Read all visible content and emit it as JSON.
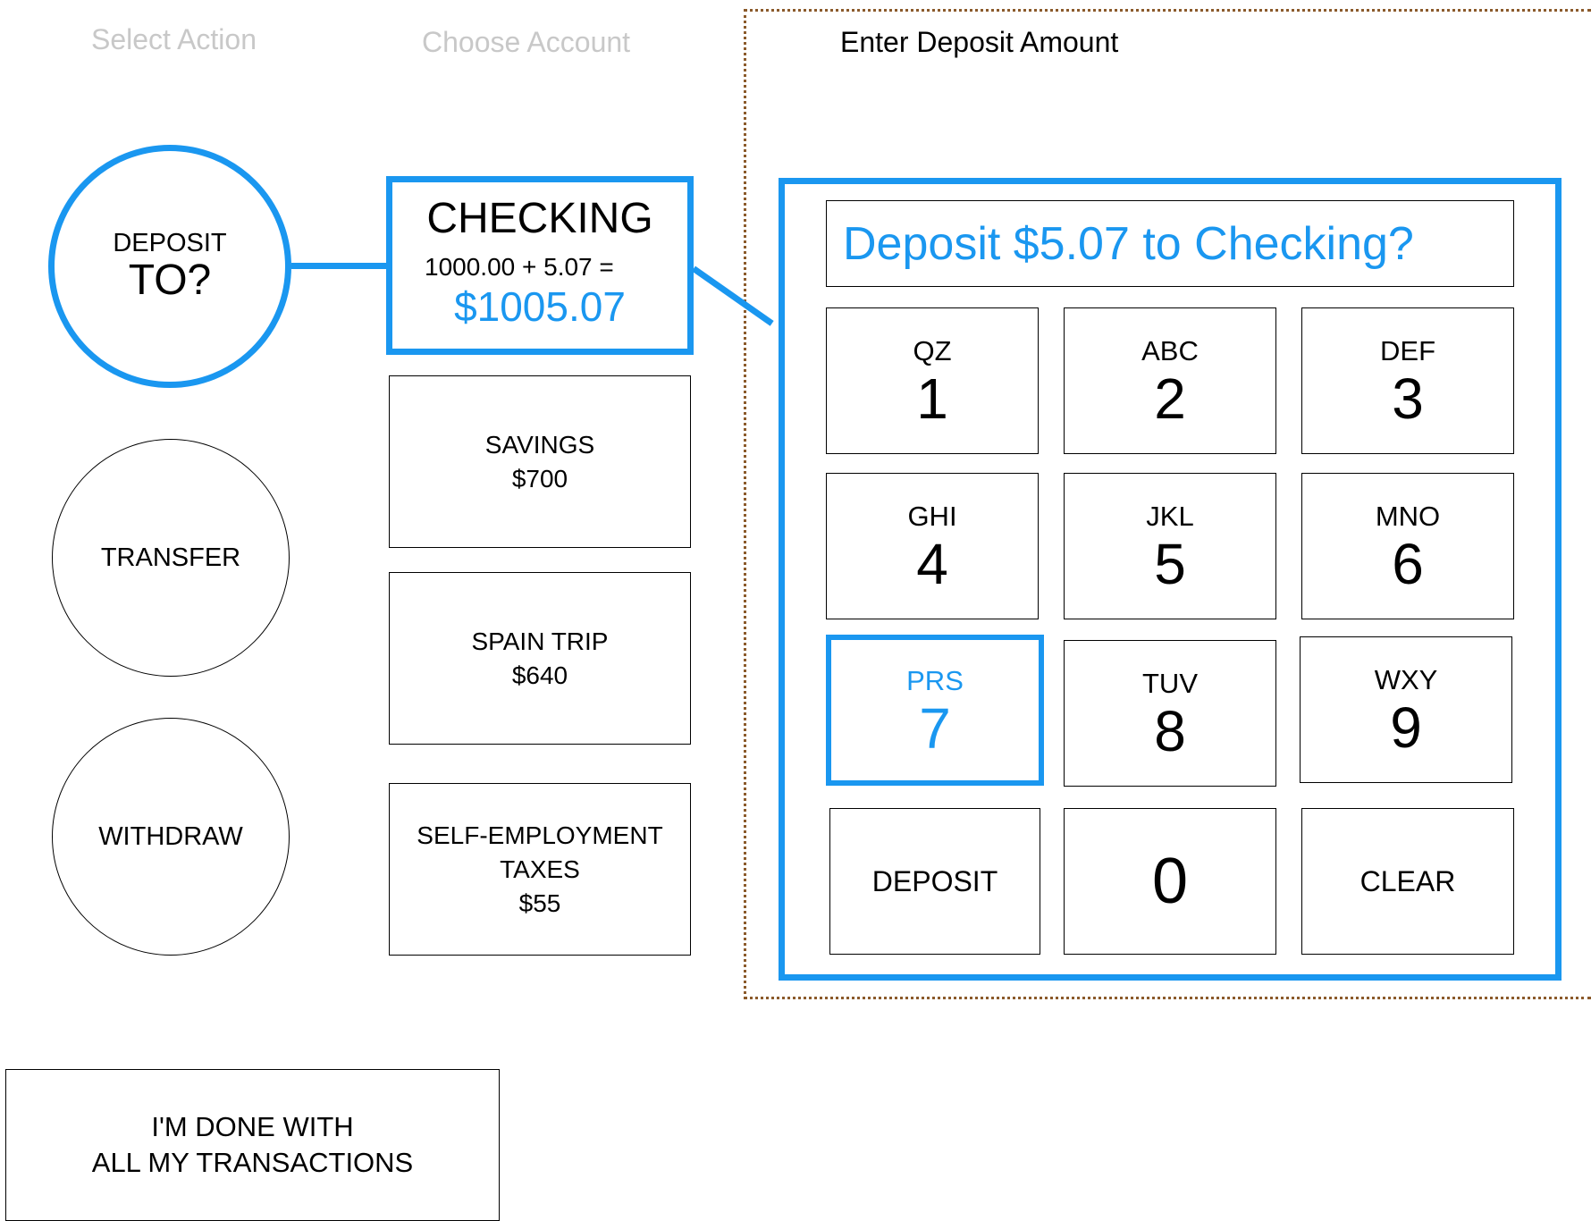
{
  "steps": {
    "select_action": "Select Action",
    "choose_account": "Choose Account",
    "enter_amount": "Enter Deposit Amount"
  },
  "actions": [
    {
      "label": "DEPOSIT",
      "sub": "TO?",
      "selected": true
    },
    {
      "label": "TRANSFER"
    },
    {
      "label": "WITHDRAW"
    }
  ],
  "accounts": {
    "checking": {
      "name": "CHECKING",
      "equation": "1000.00 + 5.07 =",
      "total": "$1005.07"
    },
    "others": [
      {
        "lines": [
          "SAVINGS",
          "$700"
        ]
      },
      {
        "lines": [
          "SPAIN TRIP",
          "$640"
        ]
      },
      {
        "lines": [
          "SELF-EMPLOYMENT",
          "TAXES",
          "$55"
        ]
      }
    ]
  },
  "keypad": {
    "display": "Deposit $5.07 to Checking?",
    "keys": [
      {
        "letters": "QZ",
        "digit": "1"
      },
      {
        "letters": "ABC",
        "digit": "2"
      },
      {
        "letters": "DEF",
        "digit": "3"
      },
      {
        "letters": "GHI",
        "digit": "4"
      },
      {
        "letters": "JKL",
        "digit": "5"
      },
      {
        "letters": "MNO",
        "digit": "6"
      },
      {
        "letters": "PRS",
        "digit": "7"
      },
      {
        "letters": "TUV",
        "digit": "8"
      },
      {
        "letters": "WXY",
        "digit": "9"
      }
    ],
    "deposit_label": "DEPOSIT",
    "zero": "0",
    "clear_label": "CLEAR"
  },
  "done": {
    "line1": "I'M DONE WITH",
    "line2": "ALL MY TRANSACTIONS"
  },
  "colors": {
    "accent": "#1a97f0",
    "dotted_border": "#8b5a2b",
    "inactive_text": "#c8c8c8"
  }
}
